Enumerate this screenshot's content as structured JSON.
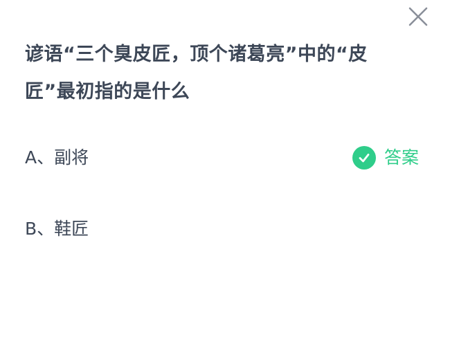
{
  "question": {
    "text": "谚语“三个臭皮匠，顶个诸葛亮”中的“皮匠”最初指的是什么"
  },
  "options": [
    {
      "label": "A、副将",
      "is_answer": true
    },
    {
      "label": "B、鞋匠",
      "is_answer": false
    }
  ],
  "answer_badge": {
    "label": "答案",
    "icon": "check-circle-icon"
  },
  "close_icon": "close-icon",
  "colors": {
    "text": "#3d4757",
    "accent_green": "#2fcd8a",
    "close": "#8a8f99",
    "background": "#ffffff"
  }
}
